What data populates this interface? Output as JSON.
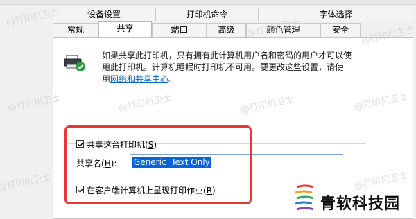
{
  "tabs_row1": [
    "设备设置",
    "打印机命令",
    "字体选择"
  ],
  "tabs_row2": [
    "常规",
    "共享",
    "端口",
    "高级",
    "颜色管理",
    "安全"
  ],
  "active_tab": "共享",
  "description": {
    "line1": "如果共享此打印机，只有拥有此计算机用户名和密码的用户才可以使",
    "line2": "用此打印机。计算机睡眠时打印机不可用。要更改这些设置，请使",
    "line3_prefix": "用",
    "link": "网络和共享中心",
    "line3_suffix": "。"
  },
  "share_checkbox": {
    "label": "共享这台打印机(",
    "accel": "S",
    "suffix": ")",
    "checked": true
  },
  "share_name": {
    "label": "共享名(",
    "accel": "H",
    "suffix": "):",
    "value": "Generic  Text Only"
  },
  "render_checkbox": {
    "label": "在客户端计算机上呈现打印作业(",
    "accel": "R",
    "suffix": ")",
    "checked": true
  },
  "watermark": "@打印机卫士",
  "brand": "青软科技园",
  "colors": {
    "highlight": "#e53935",
    "selection": "#0a64d8",
    "link": "#0066cc"
  }
}
